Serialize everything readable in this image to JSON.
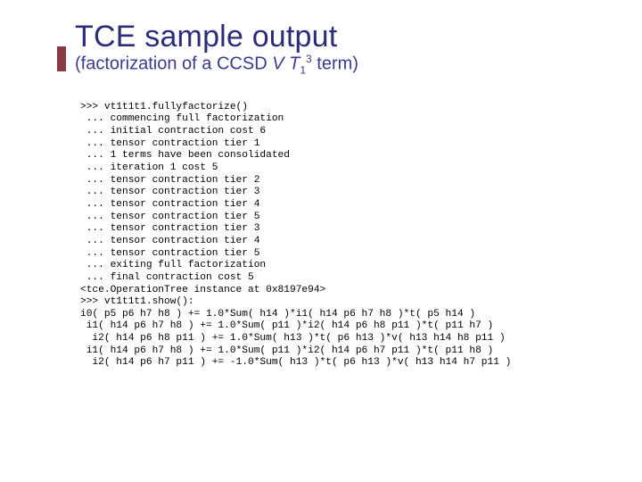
{
  "title": "TCE sample output",
  "subtitle_prefix": "(factorization of a CCSD ",
  "subtitle_v": "V",
  "subtitle_t": "T",
  "subtitle_sub": "1",
  "subtitle_sup": "3",
  "subtitle_suffix": " term)",
  "code": {
    "l00": ">>> vt1t1t1.fullyfactorize()",
    "l01": " ... commencing full factorization",
    "l02": " ... initial contraction cost 6",
    "l03": " ... tensor contraction tier 1",
    "l04": " ... 1 terms have been consolidated",
    "l05": " ... iteration 1 cost 5",
    "l06": " ... tensor contraction tier 2",
    "l07": " ... tensor contraction tier 3",
    "l08": " ... tensor contraction tier 4",
    "l09": " ... tensor contraction tier 5",
    "l10": " ... tensor contraction tier 3",
    "l11": " ... tensor contraction tier 4",
    "l12": " ... tensor contraction tier 5",
    "l13": " ... exiting full factorization",
    "l14": " ... final contraction cost 5",
    "l15": "<tce.OperationTree instance at 0x8197e94>",
    "l16": ">>> vt1t1t1.show():",
    "l17": "i0( p5 p6 h7 h8 ) += 1.0*Sum( h14 )*i1( h14 p6 h7 h8 )*t( p5 h14 )",
    "l18": " i1( h14 p6 h7 h8 ) += 1.0*Sum( p11 )*i2( h14 p6 h8 p11 )*t( p11 h7 )",
    "l19": "  i2( h14 p6 h8 p11 ) += 1.0*Sum( h13 )*t( p6 h13 )*v( h13 h14 h8 p11 )",
    "l20": " i1( h14 p6 h7 h8 ) += 1.0*Sum( p11 )*i2( h14 p6 h7 p11 )*t( p11 h8 )",
    "l21": "  i2( h14 p6 h7 p11 ) += -1.0*Sum( h13 )*t( p6 h13 )*v( h13 h14 h7 p11 )"
  }
}
